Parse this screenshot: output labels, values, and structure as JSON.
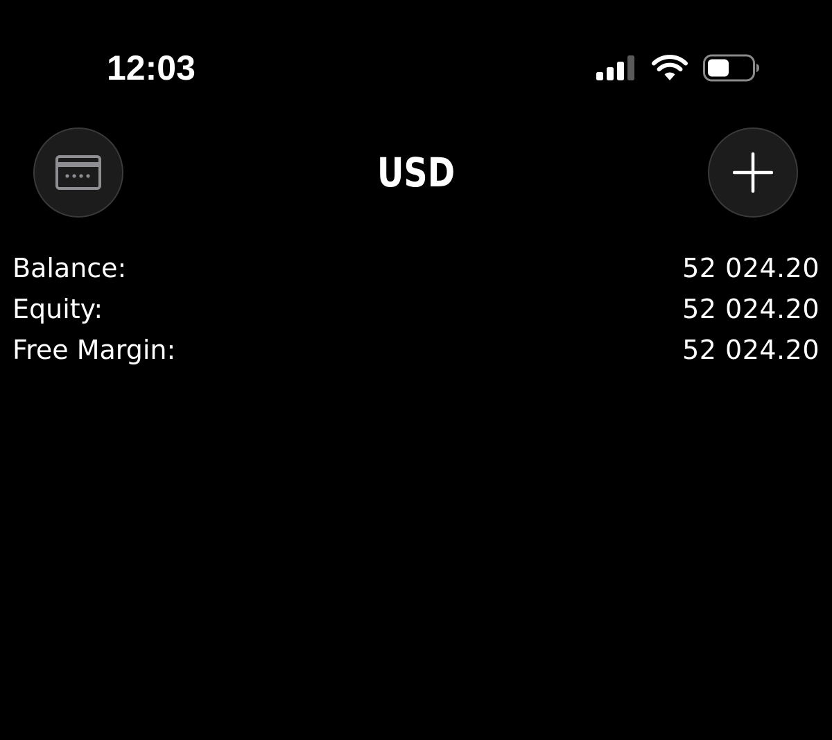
{
  "status_bar": {
    "time": "12:03",
    "icons": [
      "cellular-signal-icon",
      "wifi-icon",
      "battery-icon"
    ]
  },
  "nav": {
    "title": "USD",
    "left_button_icon": "credit-card-icon",
    "right_button_icon": "plus-icon"
  },
  "summary": {
    "rows": [
      {
        "label": "Balance:",
        "value": "52 024.20"
      },
      {
        "label": "Equity:",
        "value": "52 024.20"
      },
      {
        "label": "Free Margin:",
        "value": "52 024.20"
      }
    ]
  },
  "colors": {
    "background": "#000000",
    "text": "#ffffff",
    "button_fill": "#1c1c1c",
    "button_border": "#3a3a3a",
    "icon_gray": "#8e8e93"
  }
}
